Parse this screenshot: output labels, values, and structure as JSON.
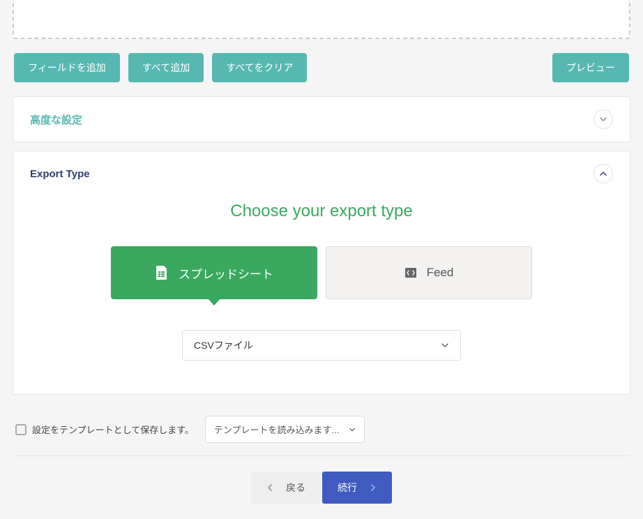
{
  "buttons": {
    "add_field": "フィールドを追加",
    "add_all": "すべて追加",
    "clear_all": "すべてをクリア",
    "preview": "プレビュー"
  },
  "advanced": {
    "title": "高度な設定"
  },
  "export": {
    "title": "Export Type",
    "choose": "Choose your export type",
    "spreadsheet": "スプレッドシート",
    "feed": "Feed",
    "select_value": "CSVファイル"
  },
  "template": {
    "save_label": "設定をテンプレートとして保存します。",
    "load_label": "テンプレートを読み込みます..."
  },
  "nav": {
    "back": "戻る",
    "next": "続行"
  }
}
